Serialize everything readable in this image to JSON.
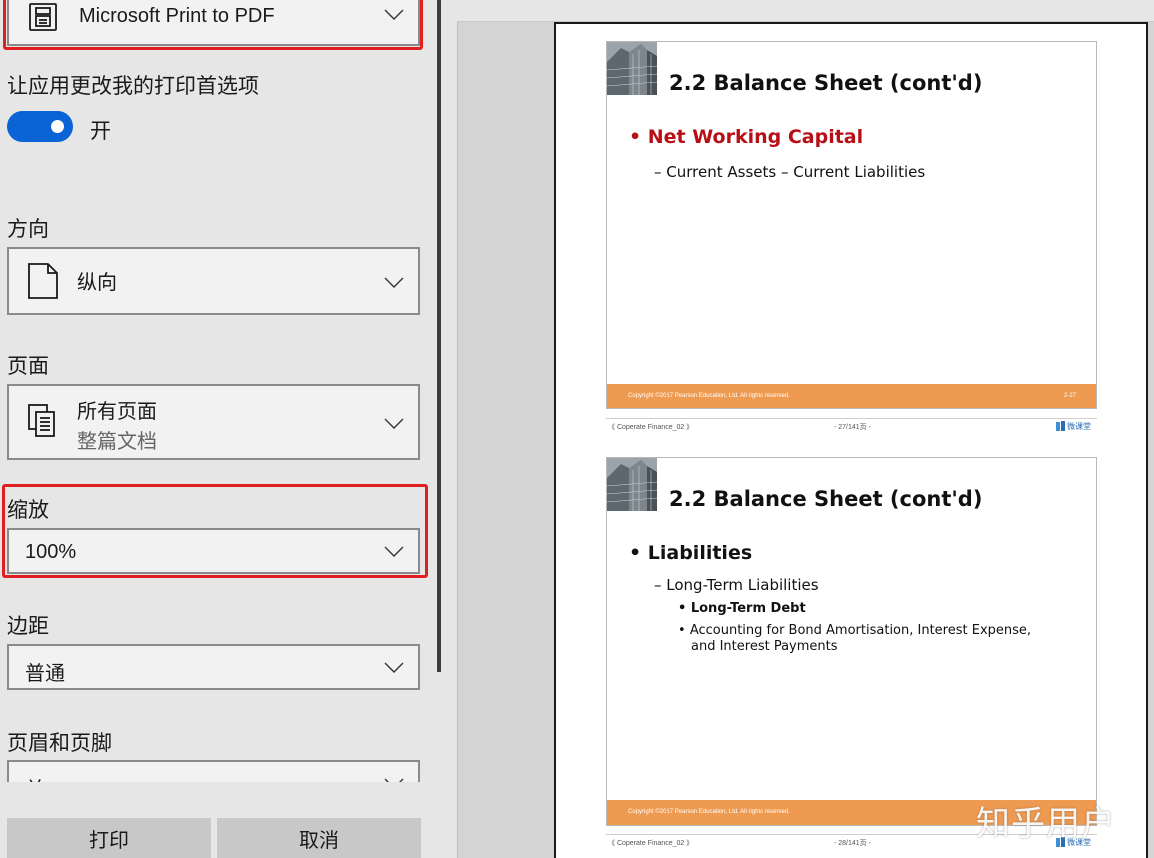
{
  "printer": {
    "value": "Microsoft Print to PDF"
  },
  "app_prefs": {
    "label": "让应用更改我的打印首选项",
    "toggle_state_label": "开",
    "toggle_on": true
  },
  "orientation": {
    "label": "方向",
    "value": "纵向"
  },
  "pages": {
    "label": "页面",
    "value": "所有页面",
    "subvalue": "整篇文档"
  },
  "scale": {
    "label": "缩放",
    "value": "100%"
  },
  "margins": {
    "label": "边距",
    "value": "普通"
  },
  "header_footer": {
    "label": "页眉和页脚",
    "value": "关"
  },
  "buttons": {
    "print": "打印",
    "cancel": "取消"
  },
  "colors": {
    "accent": "#0a64d6",
    "highlight": "#e02020",
    "slide_footer": "#ee9a50",
    "slide_accent_red": "#b80f17"
  },
  "preview": {
    "slides": [
      {
        "title": "2.2 Balance Sheet (cont'd)",
        "bullet": "Net Working Capital",
        "sub": "– Current Assets – Current Liabilities",
        "copyright": "Copyright ©2017 Pearson Education, Ltd. All rights reserved.",
        "page_label": "2-27",
        "footer_left": "《 Coperate Finance_02 》",
        "footer_center": "- 27/141页 -",
        "logo_text": "微课堂"
      },
      {
        "title": "2.2 Balance Sheet (cont'd)",
        "bullet": "Liabilities",
        "sub": "– Long-Term Liabilities",
        "items": [
          "Long-Term Debt",
          "Accounting for Bond Amortisation, Interest Expense,",
          "and Interest Payments"
        ],
        "copyright": "Copyright ©2017 Pearson Education, Ltd. All rights reserved.",
        "footer_left": "《 Coperate Finance_02 》",
        "footer_center": "- 28/141页 -",
        "logo_text": "微课堂"
      }
    ],
    "watermark": "知乎用户"
  },
  "icons": {
    "printer": "printer-icon",
    "orientation": "portrait-page-icon",
    "pages": "multiple-pages-icon",
    "chevron": "chevron-down-icon"
  }
}
